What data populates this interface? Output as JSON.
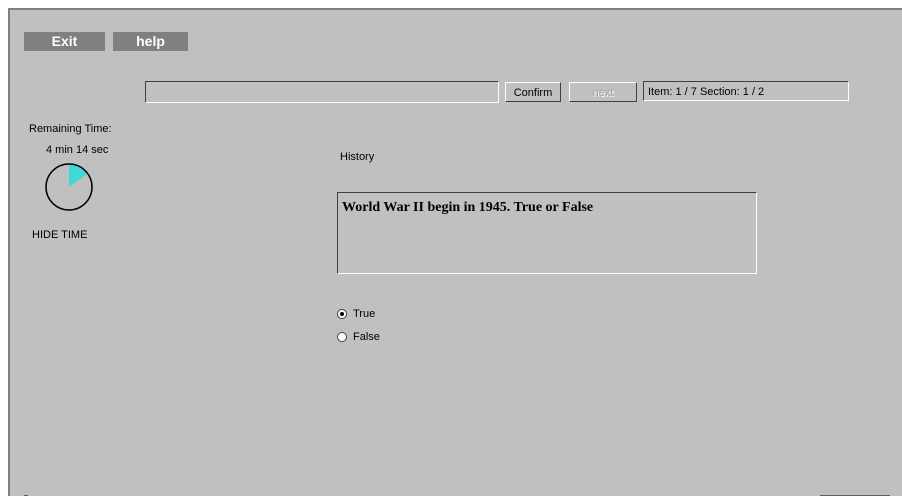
{
  "toolbar": {
    "exit_label": "Exit",
    "help_label": "help"
  },
  "navigation": {
    "confirm_label": "Confirm",
    "next_label": "next",
    "status": "Item: 1 / 7  Section: 1 / 2"
  },
  "timer": {
    "label": "Remaining Time:",
    "value": "4 min  14 sec",
    "elapsed_fraction": 0.15,
    "hide_label": "HIDE TIME"
  },
  "question": {
    "subject": "History",
    "text": "World War II begin in 1945. True or False",
    "options": [
      {
        "label": "True",
        "selected": true
      },
      {
        "label": "False",
        "selected": false
      }
    ]
  },
  "colors": {
    "background": "#c0c0c0",
    "button_gray": "#808080",
    "timer_fill": "#40d8d8"
  }
}
